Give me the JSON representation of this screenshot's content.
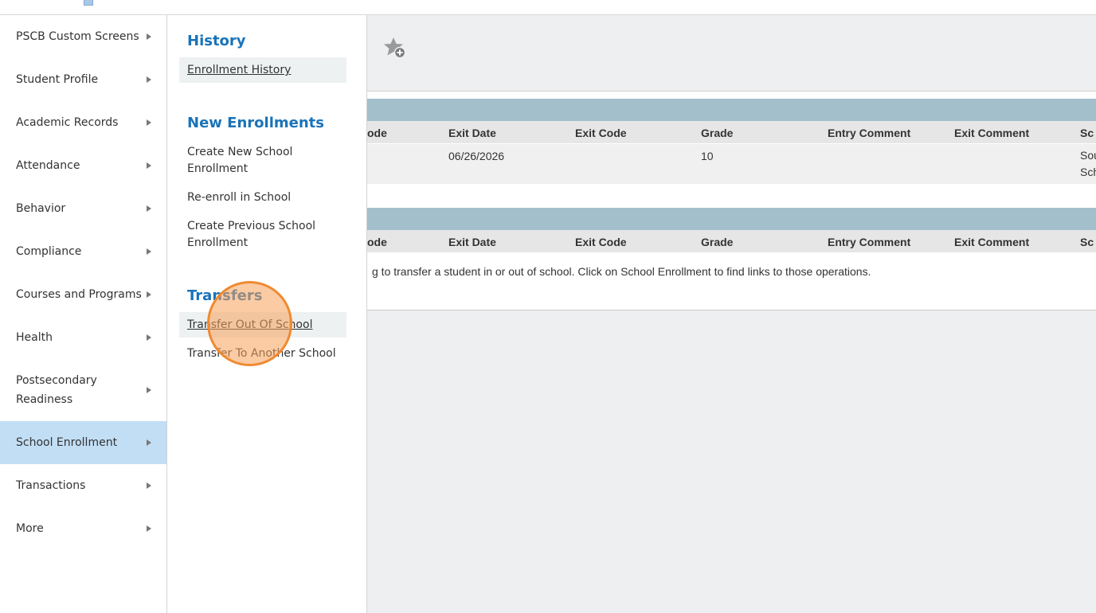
{
  "colors": {
    "accent_heading": "#1a73b8",
    "active_nav_bg": "#c2def5",
    "table_band": "#a3bfcc",
    "click_indicator": "#f08a30"
  },
  "left_nav": {
    "items": [
      {
        "label": "PSCB Custom Screens",
        "icon": "triangle-right-icon"
      },
      {
        "label": "Student Profile",
        "icon": "triangle-right-icon"
      },
      {
        "label": "Academic Records",
        "icon": "triangle-right-icon"
      },
      {
        "label": "Attendance",
        "icon": "triangle-right-icon"
      },
      {
        "label": "Behavior",
        "icon": "triangle-right-icon"
      },
      {
        "label": "Compliance",
        "icon": "triangle-right-icon"
      },
      {
        "label": "Courses and Programs",
        "icon": "triangle-right-icon"
      },
      {
        "label": "Health",
        "icon": "triangle-right-icon"
      },
      {
        "label": "Postsecondary Readiness",
        "icon": "triangle-right-icon"
      },
      {
        "label": "School Enrollment",
        "icon": "triangle-right-icon",
        "active": true
      },
      {
        "label": "Transactions",
        "icon": "triangle-right-icon"
      },
      {
        "label": "More",
        "icon": "triangle-right-icon"
      }
    ]
  },
  "flyout": {
    "history_heading": "History",
    "enrollment_history": "Enrollment History",
    "new_enrollments_heading": "New Enrollments",
    "create_new_school_enrollment": "Create New School Enrollment",
    "reenroll_in_school": "Re-enroll in School",
    "create_previous_school_enrollment": "Create Previous School Enrollment",
    "transfers_heading": "Transfers",
    "transfer_out_of_school": "Transfer Out Of School",
    "transfer_to_another_school": "Transfer To Another School"
  },
  "main": {
    "favorite_icon": "star-plus-icon",
    "table1": {
      "columns": [
        "ode",
        "Exit Date",
        "Exit Code",
        "Grade",
        "Entry Comment",
        "Exit Comment",
        "Sc"
      ],
      "row": {
        "exit_date": "06/26/2026",
        "exit_code": "",
        "grade": "10",
        "entry_comment": "",
        "exit_comment": "",
        "school_line1": "Sou",
        "school_line2": "Sch"
      }
    },
    "table2": {
      "columns": [
        "ode",
        "Exit Date",
        "Exit Code",
        "Grade",
        "Entry Comment",
        "Exit Comment",
        "Sc"
      ]
    },
    "info_underlined": "g",
    "info_text": " to transfer a student in or out of school. Click on School Enrollment to find links to those operations."
  }
}
